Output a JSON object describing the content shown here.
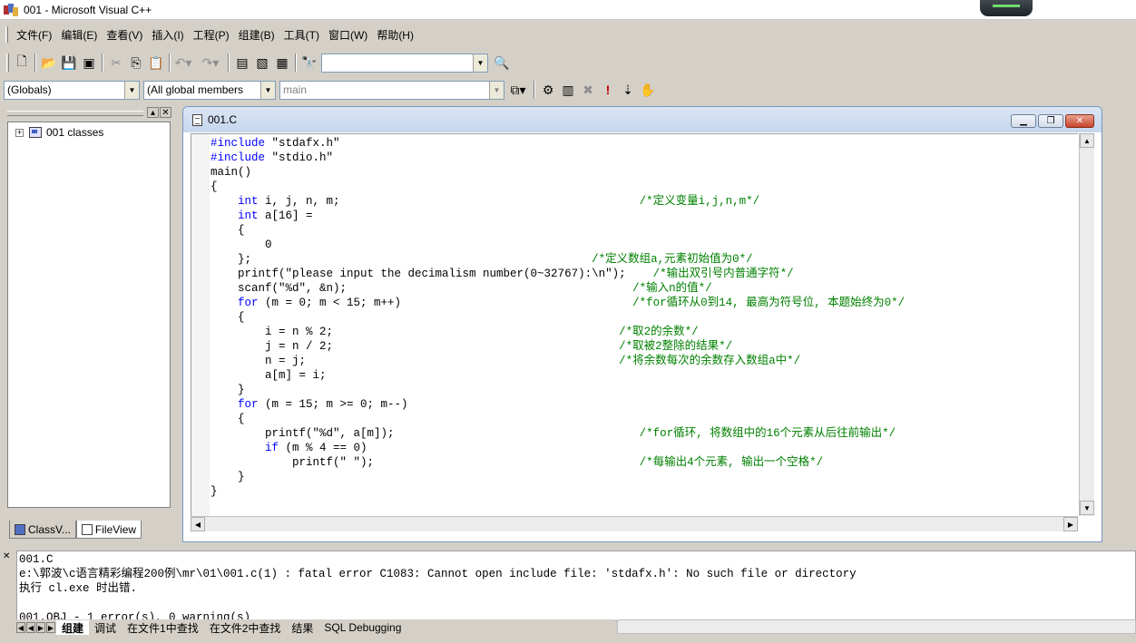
{
  "window": {
    "title": "001 - Microsoft Visual C++"
  },
  "menu": [
    "文件(F)",
    "编辑(E)",
    "查看(V)",
    "插入(I)",
    "工程(P)",
    "组建(B)",
    "工具(T)",
    "窗口(W)",
    "帮助(H)"
  ],
  "toolbar": {
    "find_value": "",
    "globals_combo": "(Globals)",
    "members_combo": "(All global members",
    "function_combo": "main"
  },
  "workspace": {
    "tree_root": "001 classes",
    "tabs": [
      "ClassV...",
      "FileView"
    ]
  },
  "editor": {
    "doc_title": "001.C",
    "lines": [
      [
        {
          "t": "#include",
          "k": "kw"
        },
        {
          "t": " \"stdafx.h\"",
          "k": ""
        }
      ],
      [
        {
          "t": "#include",
          "k": "kw"
        },
        {
          "t": " \"stdio.h\"",
          "k": ""
        }
      ],
      [
        {
          "t": "main()",
          "k": ""
        }
      ],
      [
        {
          "t": "{",
          "k": ""
        }
      ],
      [
        {
          "t": "    ",
          "k": ""
        },
        {
          "t": "int",
          "k": "kw"
        },
        {
          "t": " i, j, n, m;                                            ",
          "k": ""
        },
        {
          "t": "/*定义变量i,j,n,m*/",
          "k": "cm"
        }
      ],
      [
        {
          "t": "    ",
          "k": ""
        },
        {
          "t": "int",
          "k": "kw"
        },
        {
          "t": " a[16] =",
          "k": ""
        }
      ],
      [
        {
          "t": "    {",
          "k": ""
        }
      ],
      [
        {
          "t": "        0",
          "k": ""
        }
      ],
      [
        {
          "t": "    };                                                  ",
          "k": ""
        },
        {
          "t": "/*定义数组a,元素初始值为0*/",
          "k": "cm"
        }
      ],
      [
        {
          "t": "    printf(\"please input the decimalism number(0~32767):\\n\");    ",
          "k": ""
        },
        {
          "t": "/*输出双引号内普通字符*/",
          "k": "cm"
        }
      ],
      [
        {
          "t": "    scanf(\"%d\", &n);                                          ",
          "k": ""
        },
        {
          "t": "/*输入n的值*/",
          "k": "cm"
        }
      ],
      [
        {
          "t": "    ",
          "k": ""
        },
        {
          "t": "for",
          "k": "kw"
        },
        {
          "t": " (m = 0; m < 15; m++)                                  ",
          "k": ""
        },
        {
          "t": "/*for循环从0到14, 最高为符号位, 本题始终为0*/",
          "k": "cm"
        }
      ],
      [
        {
          "t": "    {",
          "k": ""
        }
      ],
      [
        {
          "t": "        i = n % 2;                                          ",
          "k": ""
        },
        {
          "t": "/*取2的余数*/",
          "k": "cm"
        }
      ],
      [
        {
          "t": "        j = n / 2;                                          ",
          "k": ""
        },
        {
          "t": "/*取被2整除的结果*/",
          "k": "cm"
        }
      ],
      [
        {
          "t": "        n = j;                                              ",
          "k": ""
        },
        {
          "t": "/*将余数每次的余数存入数组a中*/",
          "k": "cm"
        }
      ],
      [
        {
          "t": "        a[m] = i;",
          "k": ""
        }
      ],
      [
        {
          "t": "    }",
          "k": ""
        }
      ],
      [
        {
          "t": "    ",
          "k": ""
        },
        {
          "t": "for",
          "k": "kw"
        },
        {
          "t": " (m = 15; m >= 0; m--)",
          "k": ""
        }
      ],
      [
        {
          "t": "    {",
          "k": ""
        }
      ],
      [
        {
          "t": "        printf(\"%d\", a[m]);                                    ",
          "k": ""
        },
        {
          "t": "/*for循环, 将数组中的16个元素从后往前输出*/",
          "k": "cm"
        }
      ],
      [
        {
          "t": "        ",
          "k": ""
        },
        {
          "t": "if",
          "k": "kw"
        },
        {
          "t": " (m % 4 == 0)",
          "k": ""
        }
      ],
      [
        {
          "t": "            printf(\" \");                                       ",
          "k": ""
        },
        {
          "t": "/*每输出4个元素, 输出一个空格*/",
          "k": "cm"
        }
      ],
      [
        {
          "t": "    }",
          "k": ""
        }
      ],
      [
        {
          "t": "}",
          "k": ""
        }
      ]
    ]
  },
  "output": {
    "lines": [
      "001.C",
      "e:\\郭波\\c语言精彩编程200例\\mr\\01\\001.c(1) : fatal error C1083: Cannot open include file: 'stdafx.h': No such file or directory",
      "执行 cl.exe 时出错.",
      "",
      "001.OBJ - 1 error(s), 0 warning(s)"
    ],
    "tabs": [
      "组建",
      "调试",
      "在文件1中查找",
      "在文件2中查找",
      "结果",
      "SQL Debugging"
    ]
  },
  "colors": {
    "keyword": "#0000ff",
    "comment": "#008000",
    "chrome": "#d4d0c8"
  }
}
